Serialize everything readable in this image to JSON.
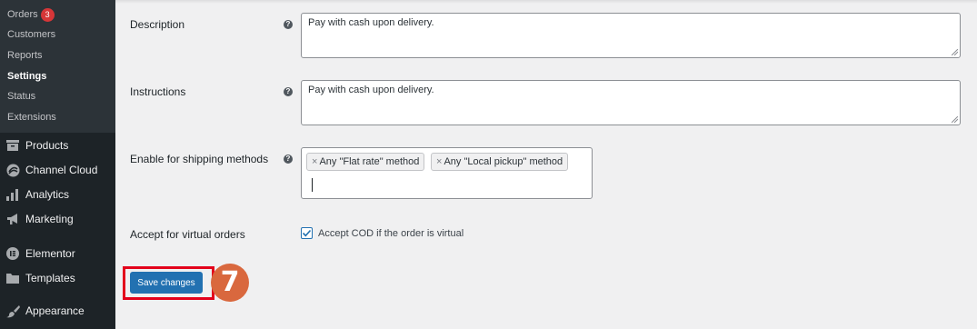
{
  "sidebar": {
    "submenu": [
      {
        "label": "Orders",
        "badge": "3"
      },
      {
        "label": "Customers"
      },
      {
        "label": "Reports"
      },
      {
        "label": "Settings",
        "current": true
      },
      {
        "label": "Status"
      },
      {
        "label": "Extensions"
      }
    ],
    "menu": [
      {
        "label": "Products",
        "icon": "archive-icon"
      },
      {
        "label": "Channel Cloud",
        "icon": "channel-cloud-icon"
      },
      {
        "label": "Analytics",
        "icon": "bar-chart-icon"
      },
      {
        "label": "Marketing",
        "icon": "megaphone-icon"
      },
      {
        "label": "Elementor",
        "icon": "elementor-icon"
      },
      {
        "label": "Templates",
        "icon": "folder-icon"
      },
      {
        "label": "Appearance",
        "icon": "paintbrush-icon"
      }
    ]
  },
  "form": {
    "description": {
      "label": "Description",
      "value": "Pay with cash upon delivery."
    },
    "instructions": {
      "label": "Instructions",
      "value": "Pay with cash upon delivery."
    },
    "shipping": {
      "label": "Enable for shipping methods",
      "tags": [
        "Any \"Flat rate\" method",
        "Any \"Local pickup\" method"
      ],
      "remove_glyph": "×"
    },
    "virtual": {
      "label": "Accept for virtual orders",
      "checkbox_label": "Accept COD if the order is virtual",
      "checked": true
    },
    "help_glyph": "?"
  },
  "actions": {
    "save_label": "Save changes"
  },
  "annotation": {
    "step": "7",
    "highlight_color": "#e3001b",
    "step_color": "#d9683e"
  },
  "colors": {
    "accent": "#2271b1",
    "sidebar_bg": "#1d2327",
    "submenu_bg": "#2c3338",
    "badge": "#d63638"
  }
}
